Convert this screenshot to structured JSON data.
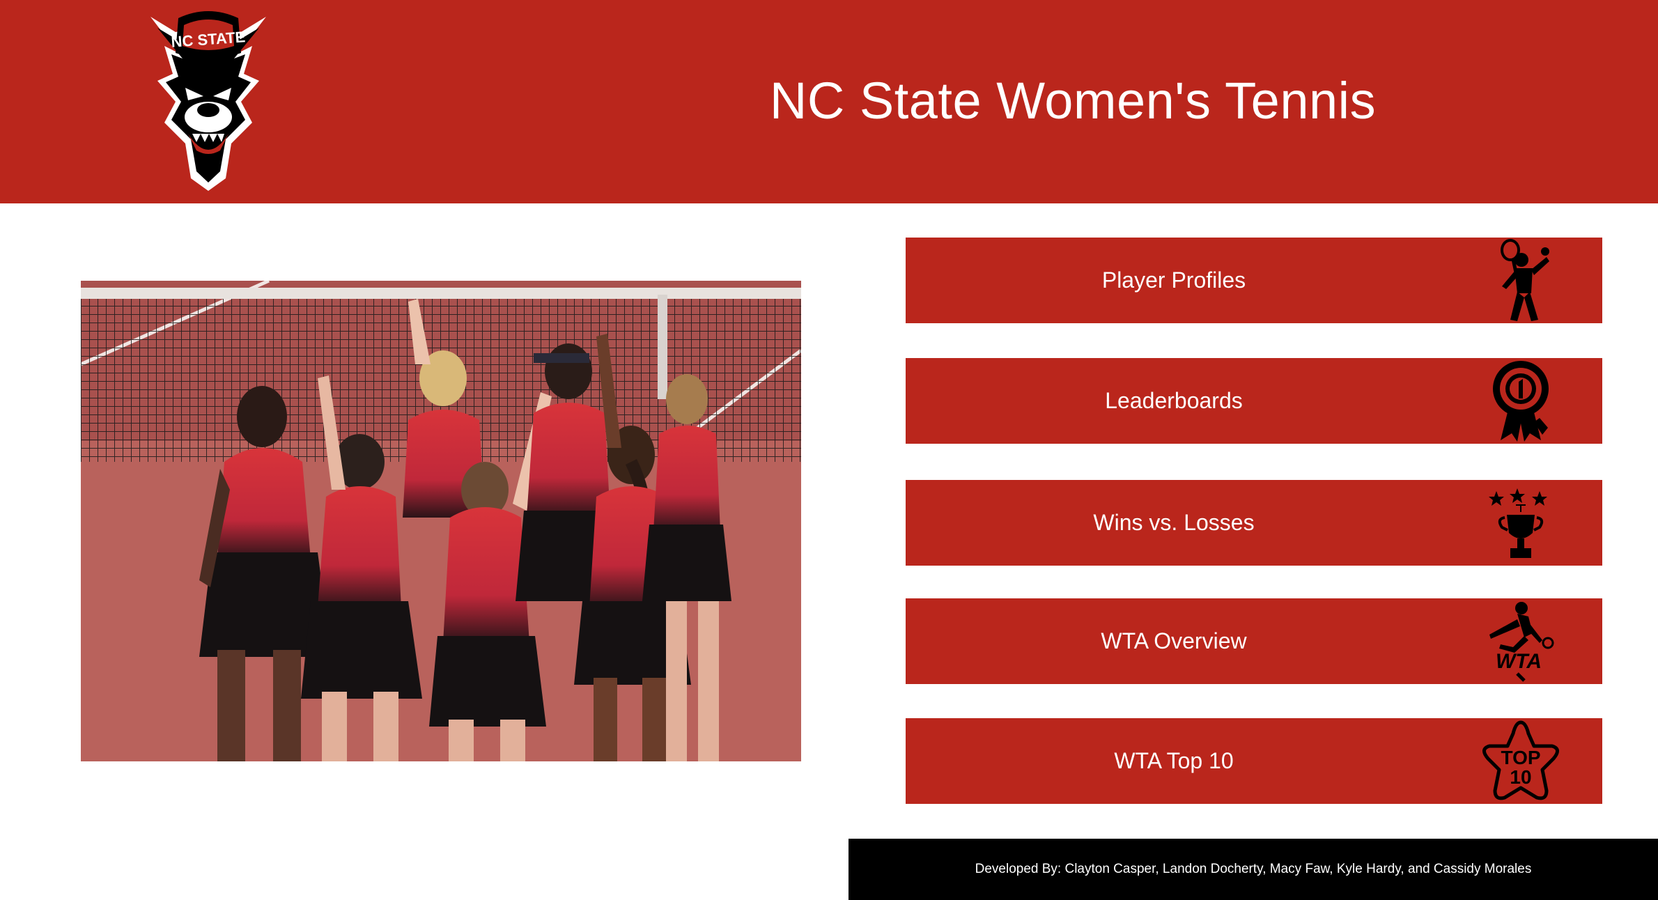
{
  "header": {
    "title": "NC State Women's Tennis",
    "logo_text": "NC STATE",
    "logo_icon": "wolf-mascot-logo"
  },
  "photo": {
    "subject": "team-celebration-photo"
  },
  "nav": {
    "items": [
      {
        "label": "Player Profiles",
        "icon": "tennis-player-icon"
      },
      {
        "label": "Leaderboards",
        "icon": "ribbon-medal-icon"
      },
      {
        "label": "Wins vs. Losses",
        "icon": "trophy-icon"
      },
      {
        "label": "WTA Overview",
        "icon": "wta-logo-icon",
        "icon_text": "WTA"
      },
      {
        "label": "WTA Top 10",
        "icon": "top-10-star-icon",
        "icon_text_1": "TOP",
        "icon_text_2": "10"
      }
    ]
  },
  "footer": {
    "text": "Developed By: Clayton Casper, Landon Docherty, Macy Faw, Kyle Hardy, and Cassidy Morales"
  },
  "colors": {
    "brand_red": "#ba261c",
    "footer_bg": "#000000",
    "text_light": "#ffffff"
  }
}
